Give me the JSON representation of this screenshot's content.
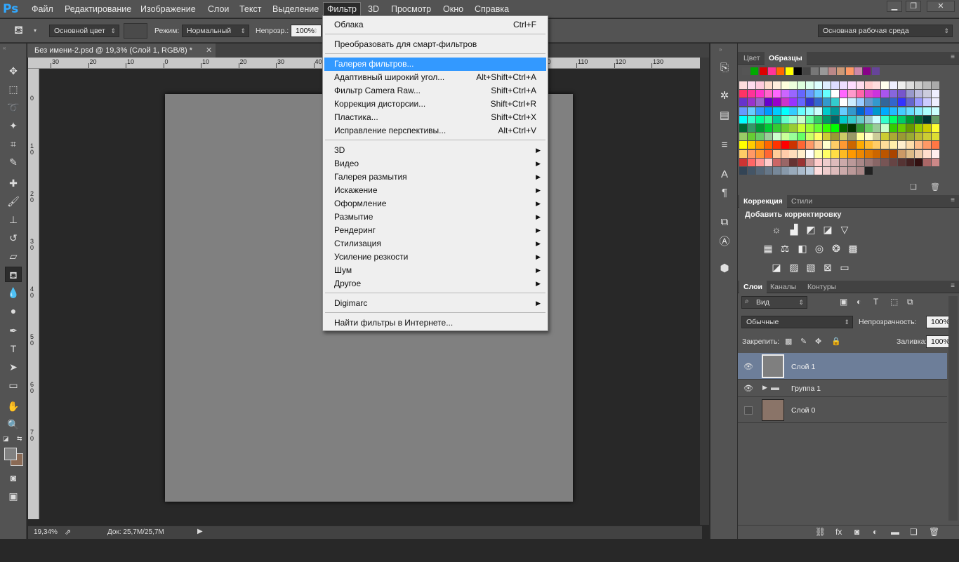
{
  "app": {
    "logo": "Ps"
  },
  "menubar": {
    "items": [
      "Файл",
      "Редактирование",
      "Изображение",
      "Слои",
      "Текст",
      "Выделение",
      "Фильтр",
      "3D",
      "Просмотр",
      "Окно",
      "Справка"
    ]
  },
  "options": {
    "source": "Основной цвет",
    "mode_label": "Режим:",
    "mode": "Нормальный",
    "opacity_label": "Непрозр.:",
    "opacity": "100%",
    "workspace": "Основная рабочая среда"
  },
  "document": {
    "tab_title": "Без имени-2.psd @ 19,3% (Слой 1, RGB/8) *",
    "zoom": "19,34%",
    "doc_info": "Док: 25,7M/25,7M"
  },
  "rulers": {
    "h": [
      "30",
      "20",
      "10",
      "0",
      "10",
      "20",
      "30",
      "40",
      "50",
      "60",
      "70",
      "80",
      "90",
      "100",
      "110",
      "120",
      "130"
    ],
    "v": [
      "0",
      "1 0",
      "2 0",
      "3 0",
      "4 0",
      "5 0",
      "6 0",
      "7 0"
    ]
  },
  "filter_menu": {
    "items": [
      {
        "label": "Облака",
        "shortcut": "Ctrl+F"
      },
      {
        "label": "Преобразовать для смарт-фильтров",
        "shortcut": ""
      },
      {
        "label": "Галерея фильтров...",
        "shortcut": ""
      },
      {
        "label": "Адаптивный широкий угол...",
        "shortcut": "Alt+Shift+Ctrl+A"
      },
      {
        "label": "Фильтр Camera Raw...",
        "shortcut": "Shift+Ctrl+A"
      },
      {
        "label": "Коррекция дисторсии...",
        "shortcut": "Shift+Ctrl+R"
      },
      {
        "label": "Пластика...",
        "shortcut": "Shift+Ctrl+X"
      },
      {
        "label": "Исправление перспективы...",
        "shortcut": "Alt+Ctrl+V"
      },
      {
        "label": "3D"
      },
      {
        "label": "Видео"
      },
      {
        "label": "Галерея размытия"
      },
      {
        "label": "Искажение"
      },
      {
        "label": "Оформление"
      },
      {
        "label": "Размытие"
      },
      {
        "label": "Рендеринг"
      },
      {
        "label": "Стилизация"
      },
      {
        "label": "Усиление резкости"
      },
      {
        "label": "Шум"
      },
      {
        "label": "Другое"
      },
      {
        "label": "Digimarc"
      },
      {
        "label": "Найти фильтры в Интернете..."
      }
    ],
    "highlighted": "Галерея фильтров..."
  },
  "swatches_panel": {
    "tabs": [
      "Цвет",
      "Образцы"
    ]
  },
  "adjustments_panel": {
    "tabs": [
      "Коррекция",
      "Стили"
    ],
    "title": "Добавить корректировку"
  },
  "layers_panel": {
    "tabs": [
      "Слои",
      "Каналы",
      "Контуры"
    ],
    "filter": "Вид",
    "blend": "Обычные",
    "opacity_label": "Непрозрачность:",
    "opacity": "100%",
    "lock_label": "Закрепить:",
    "fill_label": "Заливка:",
    "fill": "100%",
    "layers": [
      {
        "name": "Слой 1",
        "thumb": "#7f7f7f"
      },
      {
        "name": "Группа 1"
      },
      {
        "name": "Слой 0",
        "thumb": "#8a7468"
      }
    ]
  },
  "colors": {
    "foreground": "#808080",
    "background": "#8a6a55",
    "highlight": "#3399ff"
  }
}
